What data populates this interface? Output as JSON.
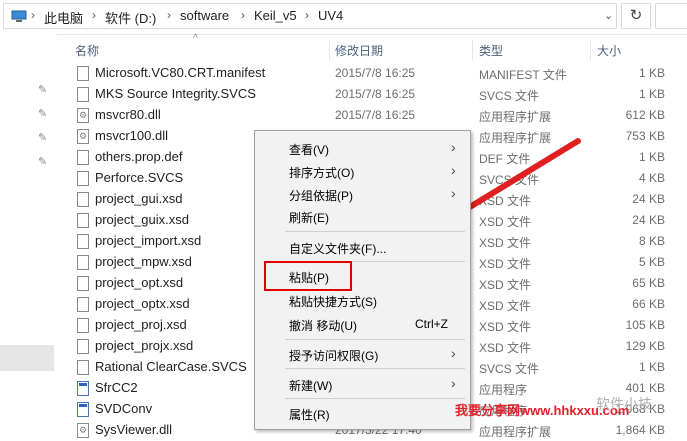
{
  "address": {
    "crumbs": [
      "此电脑",
      "软件 (D:)",
      "software",
      "Keil_v5",
      "UV4"
    ],
    "refresh_icon": "refresh-icon"
  },
  "columns": {
    "name": "名称",
    "date": "修改日期",
    "type": "类型",
    "size": "大小"
  },
  "files": [
    {
      "name": "Microsoft.VC80.CRT.manifest",
      "date": "2015/7/8 16:25",
      "type": "MANIFEST 文件",
      "size": "1 KB",
      "icon": "file"
    },
    {
      "name": "MKS Source Integrity.SVCS",
      "date": "2015/7/8 16:25",
      "type": "SVCS 文件",
      "size": "1 KB",
      "icon": "file"
    },
    {
      "name": "msvcr80.dll",
      "date": "2015/7/8 16:25",
      "type": "应用程序扩展",
      "size": "612 KB",
      "icon": "dll"
    },
    {
      "name": "msvcr100.dll",
      "date": "",
      "type": "应用程序扩展",
      "size": "753 KB",
      "icon": "dll"
    },
    {
      "name": "others.prop.def",
      "date": "",
      "type": "DEF 文件",
      "size": "1 KB",
      "icon": "file"
    },
    {
      "name": "Perforce.SVCS",
      "date": "",
      "type": "SVCS 文件",
      "size": "4 KB",
      "icon": "file"
    },
    {
      "name": "project_gui.xsd",
      "date": "",
      "type": "XSD 文件",
      "size": "24 KB",
      "icon": "file"
    },
    {
      "name": "project_guix.xsd",
      "date": "",
      "type": "XSD 文件",
      "size": "24 KB",
      "icon": "file"
    },
    {
      "name": "project_import.xsd",
      "date": "",
      "type": "XSD 文件",
      "size": "8 KB",
      "icon": "file"
    },
    {
      "name": "project_mpw.xsd",
      "date": "",
      "type": "XSD 文件",
      "size": "5 KB",
      "icon": "file"
    },
    {
      "name": "project_opt.xsd",
      "date": "",
      "type": "XSD 文件",
      "size": "65 KB",
      "icon": "file"
    },
    {
      "name": "project_optx.xsd",
      "date": "",
      "type": "XSD 文件",
      "size": "66 KB",
      "icon": "file"
    },
    {
      "name": "project_proj.xsd",
      "date": "",
      "type": "XSD 文件",
      "size": "105 KB",
      "icon": "file"
    },
    {
      "name": "project_projx.xsd",
      "date": "",
      "type": "XSD 文件",
      "size": "129 KB",
      "icon": "file"
    },
    {
      "name": "Rational ClearCase.SVCS",
      "date": "",
      "type": "SVCS 文件",
      "size": "1 KB",
      "icon": "file"
    },
    {
      "name": "SfrCC2",
      "date": "",
      "type": "应用程序",
      "size": "401 KB",
      "icon": "app"
    },
    {
      "name": "SVDConv",
      "date": "",
      "type": "应用程序",
      "size": "1,068 KB",
      "icon": "app"
    },
    {
      "name": "SysViewer.dll",
      "date": "2017/3/22 17:40",
      "type": "应用程序扩展",
      "size": "1,864 KB",
      "icon": "dll"
    }
  ],
  "context_menu": {
    "view": "查看(V)",
    "sort": "排序方式(O)",
    "group": "分组依据(P)",
    "refresh": "刷新(E)",
    "customize": "自定义文件夹(F)...",
    "paste": "粘贴(P)",
    "paste_shortcut": "粘贴快捷方式(S)",
    "undo": "撤消 移动(U)",
    "undo_shortcut": "Ctrl+Z",
    "grant": "授予访问权限(G)",
    "new": "新建(W)",
    "properties": "属性(R)"
  },
  "watermark": {
    "text": "我要分享网www.hhkxxu.com",
    "text2": "软件小技"
  },
  "colors": {
    "highlight_box": "#e00000",
    "arrow": "#e02020"
  }
}
